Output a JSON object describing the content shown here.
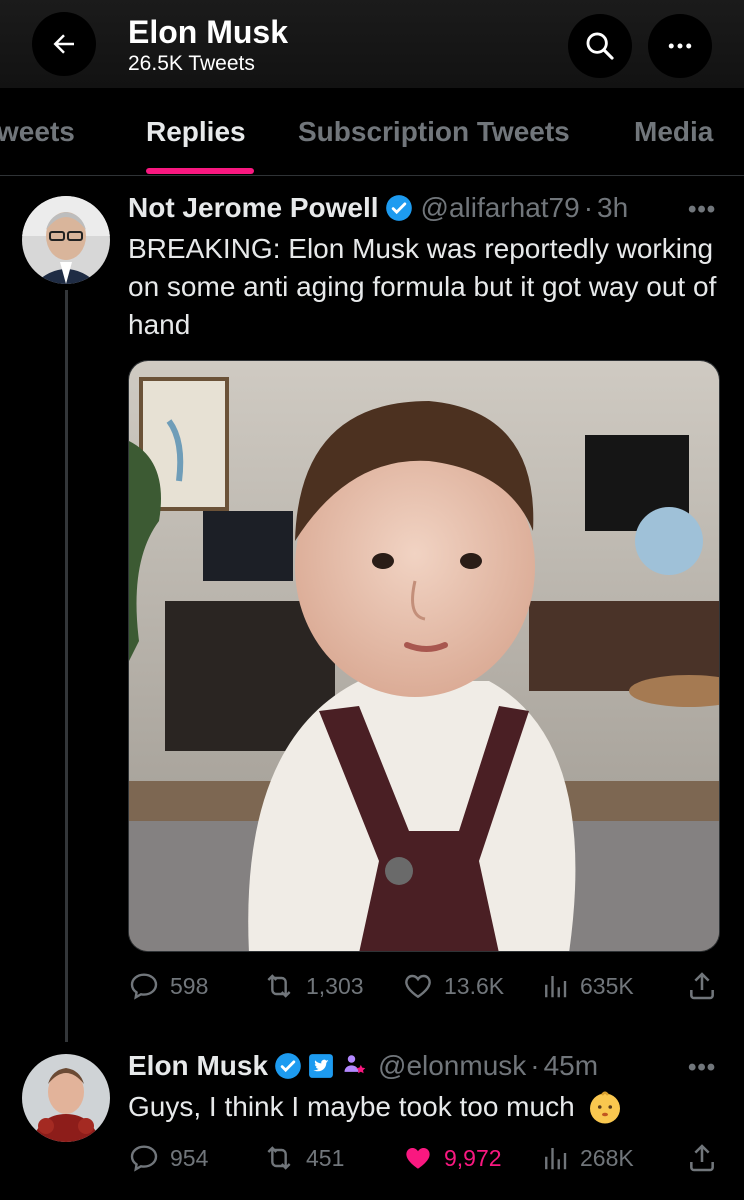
{
  "header": {
    "title": "Elon Musk",
    "subtitle": "26.5K Tweets",
    "icons": {
      "back": "back-arrow-icon",
      "search": "search-icon",
      "more": "more-icon"
    }
  },
  "tabs": [
    {
      "label": "Tweets",
      "active": false
    },
    {
      "label": "Replies",
      "active": true
    },
    {
      "label": "Subscription Tweets",
      "active": false
    },
    {
      "label": "Media",
      "active": false
    }
  ],
  "accent_color": "#f91880",
  "verified_color": "#1d9bf0",
  "tweets": [
    {
      "name": "Not Jerome Powell",
      "handle": "@alifarhat79",
      "separator": "·",
      "time": "3h",
      "more": "•••",
      "text": "BREAKING: Elon Musk was reportedly working on some anti aging formula but it got way out of hand",
      "has_media": true,
      "actions": {
        "replies": "598",
        "retweets": "1,303",
        "likes": "13.6K",
        "views": "635K",
        "liked": false
      }
    },
    {
      "name": "Elon Musk",
      "handle": "@elonmusk",
      "separator": "·",
      "time": "45m",
      "more": "•••",
      "text": "Guys, I think I maybe took too much",
      "emoji": "baby-face-emoji",
      "actions": {
        "replies": "954",
        "retweets": "451",
        "likes": "9,972",
        "views": "268K",
        "liked": true
      }
    }
  ]
}
